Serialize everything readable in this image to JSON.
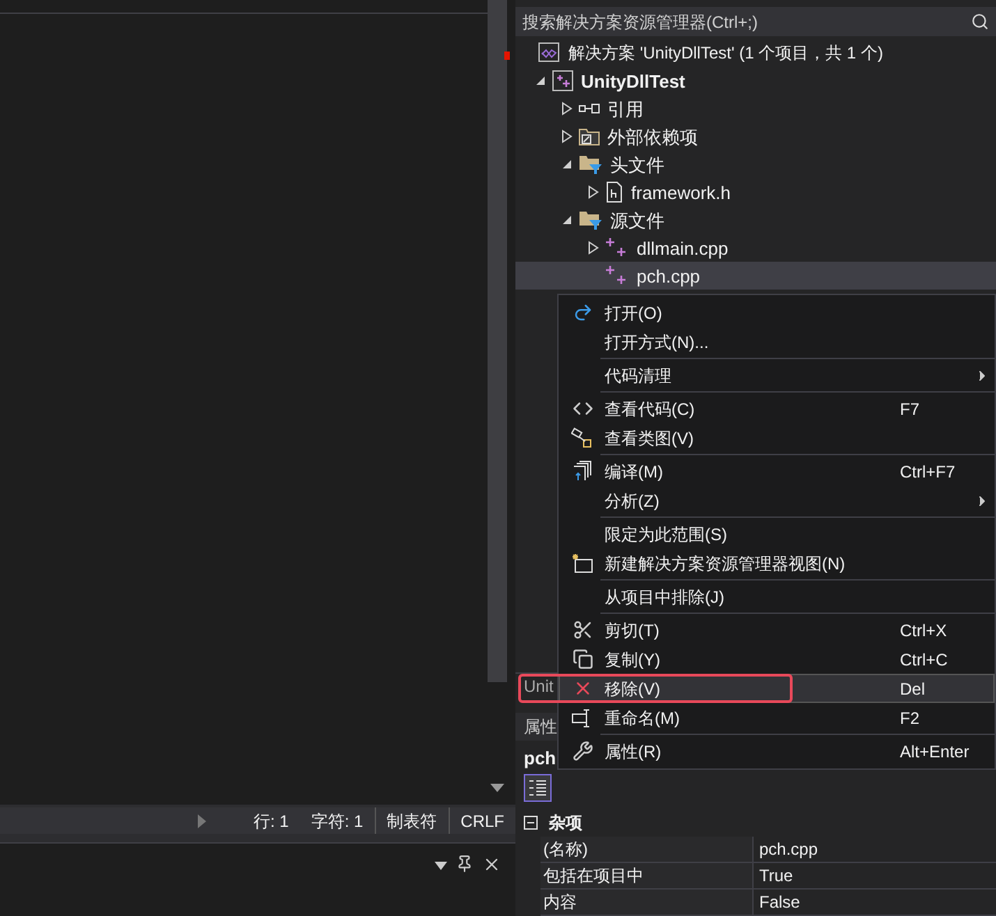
{
  "editor": {
    "status_bar": [
      "行: 1",
      "字符: 1",
      "制表符",
      "CRLF"
    ]
  },
  "solution_explorer": {
    "search_placeholder": "搜索解决方案资源管理器(Ctrl+;)",
    "solution": {
      "label": "解决方案 'UnityDllTest' (1 个项目，共 1 个)"
    },
    "tree": [
      {
        "label": "UnityDllTest",
        "kind": "project",
        "expanded": true,
        "selected": false,
        "children": [
          {
            "label": "引用",
            "kind": "references",
            "expanded": false,
            "selected": false
          },
          {
            "label": "外部依赖项",
            "kind": "external",
            "expanded": false,
            "selected": false
          },
          {
            "label": "头文件",
            "kind": "filter",
            "expanded": true,
            "selected": false,
            "children": [
              {
                "label": "framework.h",
                "kind": "header",
                "expanded": false,
                "selected": false
              }
            ]
          },
          {
            "label": "源文件",
            "kind": "filter",
            "expanded": true,
            "selected": false,
            "children": [
              {
                "label": "dllmain.cpp",
                "kind": "source",
                "expanded": false,
                "selected": false
              },
              {
                "label": "pch.cpp",
                "kind": "source",
                "selected": true
              }
            ]
          }
        ]
      }
    ],
    "bottom_tab": "Unit"
  },
  "properties": {
    "title": "属性",
    "object": "pch",
    "category": "杂项",
    "rows": [
      {
        "name": "(名称)",
        "value": "pch.cpp"
      },
      {
        "name": "包括在项目中",
        "value": "True"
      },
      {
        "name": "内容",
        "value": "False"
      }
    ]
  },
  "context_menu": [
    {
      "kind": "item",
      "label": "打开(O)",
      "highlighted": false
    },
    {
      "kind": "item",
      "label": "打开方式(N)...",
      "highlighted": false
    },
    {
      "kind": "separator"
    },
    {
      "kind": "item",
      "label": "代码清理",
      "submenu": true,
      "highlighted": false
    },
    {
      "kind": "separator"
    },
    {
      "kind": "item",
      "label": "查看代码(C)",
      "shortcut": "F7",
      "highlighted": false
    },
    {
      "kind": "item",
      "label": "查看类图(V)",
      "highlighted": false
    },
    {
      "kind": "separator"
    },
    {
      "kind": "item",
      "label": "编译(M)",
      "shortcut": "Ctrl+F7",
      "highlighted": false
    },
    {
      "kind": "item",
      "label": "分析(Z)",
      "submenu": true,
      "highlighted": false
    },
    {
      "kind": "separator"
    },
    {
      "kind": "item",
      "label": "限定为此范围(S)",
      "highlighted": false
    },
    {
      "kind": "item",
      "label": "新建解决方案资源管理器视图(N)",
      "highlighted": false
    },
    {
      "kind": "separator"
    },
    {
      "kind": "item",
      "label": "从项目中排除(J)",
      "highlighted": false
    },
    {
      "kind": "separator"
    },
    {
      "kind": "item",
      "label": "剪切(T)",
      "shortcut": "Ctrl+X",
      "highlighted": false
    },
    {
      "kind": "item",
      "label": "复制(Y)",
      "shortcut": "Ctrl+C",
      "highlighted": false
    },
    {
      "kind": "item",
      "label": "移除(V)",
      "shortcut": "Del",
      "highlighted": true
    },
    {
      "kind": "item",
      "label": "重命名(M)",
      "shortcut": "F2",
      "highlighted": false
    },
    {
      "kind": "separator"
    },
    {
      "kind": "item",
      "label": "属性(R)",
      "shortcut": "Alt+Enter",
      "highlighted": false
    }
  ]
}
